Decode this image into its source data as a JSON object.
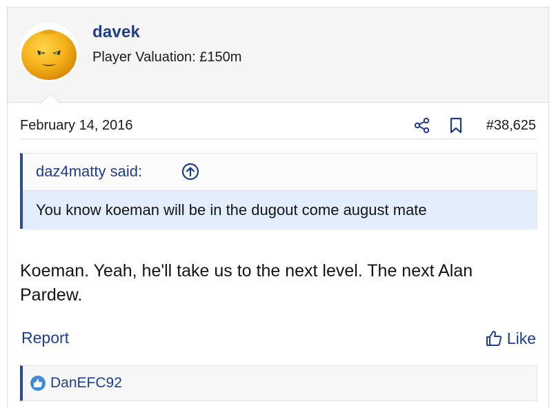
{
  "user": {
    "name": "davek",
    "valuation": "Player Valuation: £150m",
    "avatar_icon": "orange-face-avatar"
  },
  "meta": {
    "date": "February 14, 2016",
    "share_icon": "share-icon",
    "bookmark_icon": "bookmark-icon",
    "post_number": "#38,625"
  },
  "quote": {
    "author": "daz4matty said:",
    "text": "You know koeman will be in the dugout come august mate"
  },
  "message": "Koeman. Yeah, he'll take us to the next level. The next Alan Pardew.",
  "actions": {
    "report_label": "Report",
    "like_label": "Like"
  },
  "reactions": {
    "users": [
      "DanEFC92"
    ]
  },
  "colors": {
    "link": "#1d3d8f",
    "quote_accent": "#2b4a9e",
    "quote_body_bg": "#e2eefc",
    "header_bg": "#f5f5f5"
  }
}
